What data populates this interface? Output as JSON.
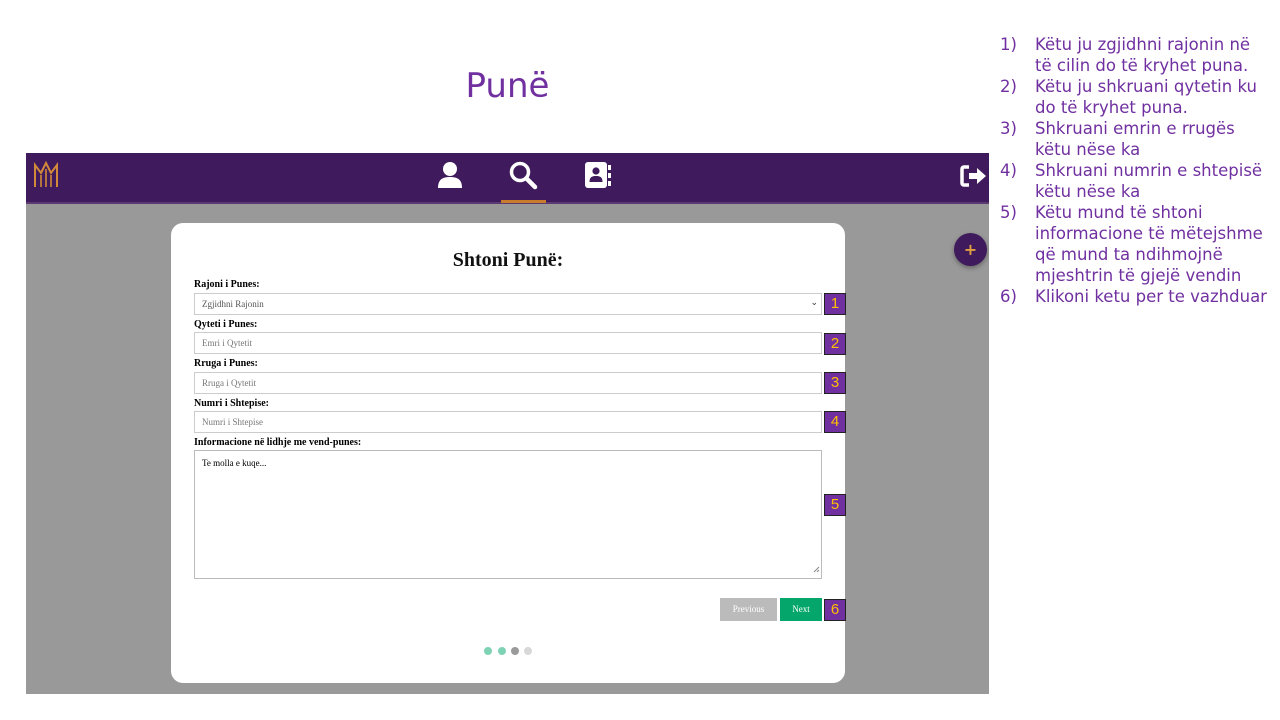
{
  "slide": {
    "title": "Punë"
  },
  "navbar": {
    "icons": [
      "logo-icon",
      "user-icon",
      "search-icon",
      "contact-book-icon",
      "logout-icon"
    ],
    "active_tab": "search",
    "background": "#3f1a5c",
    "accent": "#c97b2e"
  },
  "fab": {
    "label": "+"
  },
  "form": {
    "title": "Shtoni Punë:",
    "region": {
      "label": "Rajoni i Punes:",
      "value": "Zgjidhni Rajonin"
    },
    "city": {
      "label": "Qyteti i Punes:",
      "placeholder": "Emri i Qytetit"
    },
    "street": {
      "label": "Rruga i Punes:",
      "placeholder": "Rruga i Qytetit"
    },
    "house_number": {
      "label": "Numri i Shtepise:",
      "placeholder": "Numri i Shtepise"
    },
    "info": {
      "label": "Informacione në lidhje me vend-punes:",
      "placeholder": "Te molla e kuqe..."
    },
    "previous_label": "Previous",
    "next_label": "Next",
    "steps": {
      "total": 4,
      "current": 3
    },
    "colors": {
      "next": "#04a66b",
      "previous": "#bbbbbb"
    }
  },
  "badges": [
    "1",
    "2",
    "3",
    "4",
    "5",
    "6"
  ],
  "instructions": [
    {
      "num": "1)",
      "text": "Këtu ju zgjidhni rajonin në të cilin do të kryhet puna."
    },
    {
      "num": "2)",
      "text": "Këtu ju shkruani qytetin ku do të kryhet puna."
    },
    {
      "num": "3)",
      "text": "Shkruani emrin e rrugës këtu nëse ka"
    },
    {
      "num": "4)",
      "text": "Shkruani numrin e shtepisë këtu nëse ka"
    },
    {
      "num": "5)",
      "text": "Këtu mund të shtoni informacione të mëtejshme që mund ta ndihmojnë mjeshtrin të gjejë vendin"
    },
    {
      "num": "6)",
      "text": "Klikoni ketu per te vazhduar"
    }
  ],
  "colors": {
    "title": "#7030a0",
    "badge_bg": "#7030a0",
    "badge_text": "#ffc000",
    "app_bg": "#999999"
  }
}
